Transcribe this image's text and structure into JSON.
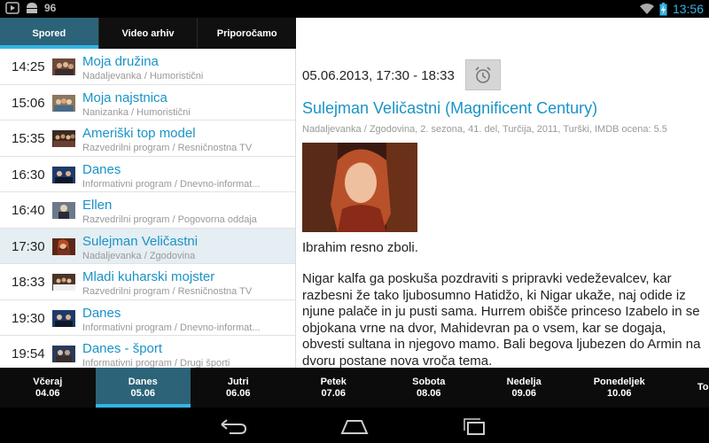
{
  "status_bar": {
    "notification_count": "96",
    "time": "13:56",
    "icons": [
      "play-store-icon",
      "android-robot-icon",
      "wifi-icon",
      "battery-charging-icon"
    ]
  },
  "tabs": [
    {
      "label": "Spored",
      "active": true
    },
    {
      "label": "Video arhiv",
      "active": false
    },
    {
      "label": "Priporočamo",
      "active": false
    }
  ],
  "schedule": [
    {
      "time": "14:25",
      "title": "Moja družina",
      "subtitle": "Nadaljevanka / Humoristični"
    },
    {
      "time": "15:06",
      "title": "Moja najstnica",
      "subtitle": "Nanizanka / Humoristični"
    },
    {
      "time": "15:35",
      "title": "Ameriški top model",
      "subtitle": "Razvedrilni program / Resničnostna TV"
    },
    {
      "time": "16:30",
      "title": "Danes",
      "subtitle": "Informativni program / Dnevno-informat..."
    },
    {
      "time": "16:40",
      "title": "Ellen",
      "subtitle": "Razvedrilni program / Pogovorna oddaja"
    },
    {
      "time": "17:30",
      "title": "Sulejman Veličastni",
      "subtitle": "Nadaljevanka / Zgodovina",
      "selected": true
    },
    {
      "time": "18:33",
      "title": "Mladi kuharski mojster",
      "subtitle": "Razvedrilni program / Resničnostna TV"
    },
    {
      "time": "19:30",
      "title": "Danes",
      "subtitle": "Informativni program / Dnevno-informat..."
    },
    {
      "time": "19:54",
      "title": "Danes - šport",
      "subtitle": "Informativni program / Drugi športi"
    }
  ],
  "detail": {
    "datetime": "05.06.2013, 17:30 - 18:33",
    "alarm_icon": "alarm-clock-icon",
    "title": "Sulejman Veličastni (Magnificent Century)",
    "meta": "Nadaljevanka / Zgodovina, 2. sezona, 41. del, Turčija, 2011, Turški, IMDB ocena: 5.5",
    "lead": "Ibrahim resno zboli.",
    "body": "Nigar kalfa ga poskuša pozdraviti s pripravki vedeževalcev, kar razbesni že tako ljubosumno Hatidžo, ki Nigar ukaže, naj odide iz njune palače in ju pusti sama. Hurrem obišče princeso Izabelo in se objokana vrne na dvor, Mahidevran pa o vsem, kar se dogaja, obvesti sultana in njegovo mamo. Bali begova ljubezen do Armin na dvoru postane nova vroča tema."
  },
  "days": [
    {
      "name": "Včeraj",
      "date": "04.06",
      "active": false
    },
    {
      "name": "Danes",
      "date": "05.06",
      "active": true
    },
    {
      "name": "Jutri",
      "date": "06.06",
      "active": false
    },
    {
      "name": "Petek",
      "date": "07.06",
      "active": false
    },
    {
      "name": "Sobota",
      "date": "08.06",
      "active": false
    },
    {
      "name": "Nedelja",
      "date": "09.06",
      "active": false
    },
    {
      "name": "Ponedeljek",
      "date": "10.06",
      "active": false
    },
    {
      "name": "To",
      "date": "",
      "active": false
    }
  ],
  "nav": [
    "back-icon",
    "home-icon",
    "recent-apps-icon"
  ],
  "colors": {
    "accent": "#33b5e5",
    "link": "#1a93c7",
    "active_tab": "#2c6378"
  }
}
